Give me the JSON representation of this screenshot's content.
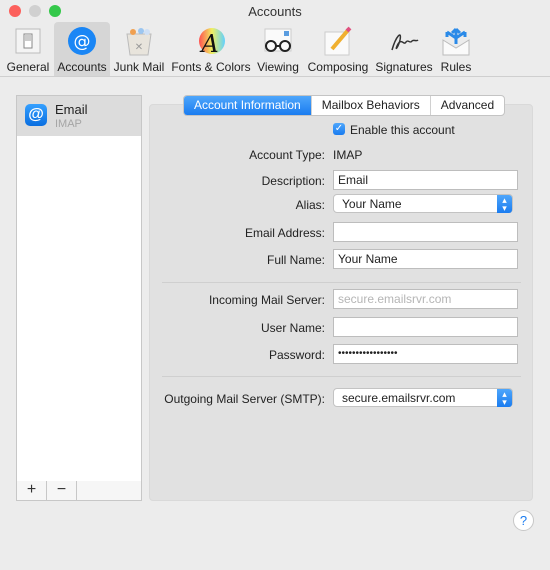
{
  "window": {
    "title": "Accounts"
  },
  "toolbar": {
    "items": [
      {
        "label": "General",
        "icon": "general-switch-icon"
      },
      {
        "label": "Accounts",
        "icon": "at-sign-icon",
        "selected": true
      },
      {
        "label": "Junk Mail",
        "icon": "trash-bin-icon"
      },
      {
        "label": "Fonts & Colors",
        "icon": "font-color-wheel-icon"
      },
      {
        "label": "Viewing",
        "icon": "glasses-icon"
      },
      {
        "label": "Composing",
        "icon": "pencil-icon"
      },
      {
        "label": "Signatures",
        "icon": "signature-icon"
      },
      {
        "label": "Rules",
        "icon": "envelope-arrows-icon"
      }
    ]
  },
  "accounts_list": {
    "items": [
      {
        "name": "Email",
        "type": "IMAP"
      }
    ],
    "add_label": "+",
    "remove_label": "−"
  },
  "tabs": [
    {
      "label": "Account Information",
      "selected": true
    },
    {
      "label": "Mailbox Behaviors"
    },
    {
      "label": "Advanced"
    }
  ],
  "form": {
    "enable_label": "Enable this account",
    "enable_checked": true,
    "account_type_label": "Account Type:",
    "account_type_value": "IMAP",
    "description_label": "Description:",
    "description_value": "Email",
    "alias_label": "Alias:",
    "alias_value": "Your Name",
    "email_label": "Email Address:",
    "email_value": "",
    "fullname_label": "Full Name:",
    "fullname_value": "Your Name",
    "incoming_label": "Incoming Mail Server:",
    "incoming_placeholder": "secure.emailsrvr.com",
    "username_label": "User Name:",
    "username_value": "",
    "password_label": "Password:",
    "password_value": "•••••••••••••••••",
    "smtp_label": "Outgoing Mail Server (SMTP):",
    "smtp_value": "secure.emailsrvr.com"
  },
  "help_label": "?",
  "colors": {
    "accent": "#1a7cf0",
    "close": "#fc605c",
    "min": "#d0d0d0",
    "max": "#34c84a"
  }
}
